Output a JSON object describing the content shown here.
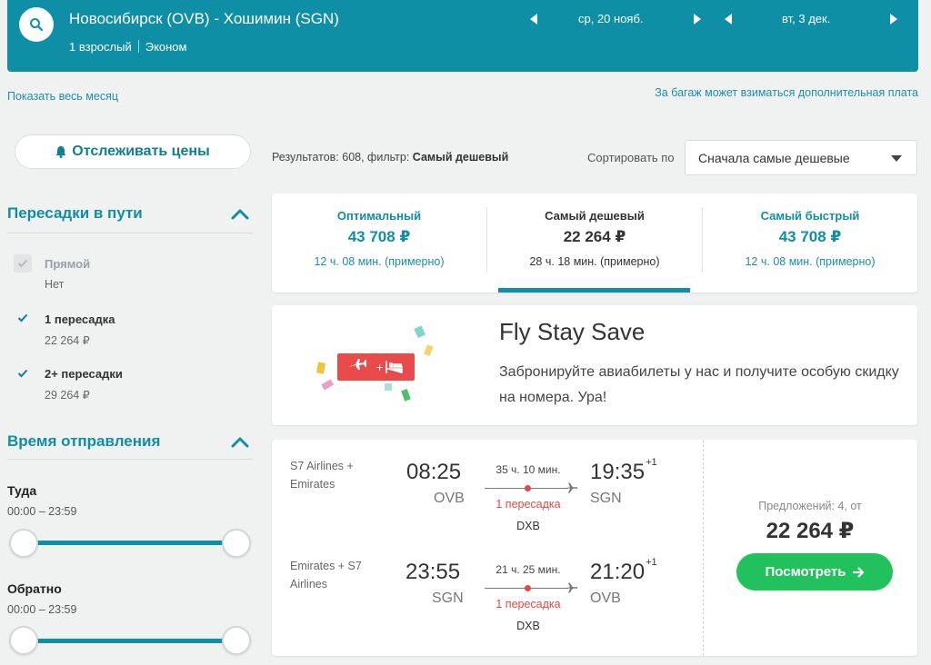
{
  "header": {
    "route": "Новосибирск (OVB) - Хошимин (SGN)",
    "passengers": "1 взрослый",
    "cabin": "Эконом",
    "depart_date": "ср, 20 нояб.",
    "return_date": "вт, 3 дек."
  },
  "links": {
    "show_month": "Показать весь месяц",
    "baggage_note": "За багаж может взиматься дополнительная плата"
  },
  "track_prices": {
    "label": "Отслеживать цены"
  },
  "filters": {
    "stops": {
      "title": "Пересадки в пути",
      "options": [
        {
          "label": "Прямой",
          "price": "Нет",
          "checked": true,
          "disabled": true
        },
        {
          "label": "1 пересадка",
          "price": "22 264 ₽",
          "checked": true,
          "disabled": false
        },
        {
          "label": "2+ пересадки",
          "price": "29 264 ₽",
          "checked": true,
          "disabled": false
        }
      ]
    },
    "departure_time": {
      "title": "Время отправления",
      "outbound_label": "Туда",
      "outbound_range": "00:00 – 23:59",
      "return_label": "Обратно",
      "return_range": "00:00 – 23:59"
    }
  },
  "results": {
    "count_prefix": "Результатов: 608, фильтр:",
    "filter_name": "Самый дешевый",
    "sort_label": "Сортировать по",
    "sort_value": "Сначала самые дешевые"
  },
  "tabs": [
    {
      "title": "Оптимальный",
      "price": "43 708 ₽",
      "duration": "12 ч. 08 мин. (примерно)"
    },
    {
      "title": "Самый дешевый",
      "price": "22 264 ₽",
      "duration": "28 ч. 18 мин. (примерно)"
    },
    {
      "title": "Самый быстрый",
      "price": "43 708 ₽",
      "duration": "12 ч. 08 мин. (примерно)"
    }
  ],
  "promo": {
    "title": "Fly Stay Save",
    "text": "Забронируйте авиабилеты у нас и получите особую скидку на номера. Ура!"
  },
  "ticket": {
    "legs": [
      {
        "airline": "S7 Airlines + Emirates",
        "dep_time": "08:25",
        "dep_code": "OVB",
        "arr_time": "19:35",
        "arr_sup": "+1",
        "arr_code": "SGN",
        "duration": "35 ч. 10 мин.",
        "stops": "1 пересадка",
        "via": "DXB"
      },
      {
        "airline": "Emirates + S7 Airlines",
        "dep_time": "23:55",
        "dep_code": "SGN",
        "arr_time": "21:20",
        "arr_sup": "+1",
        "arr_code": "OVB",
        "duration": "21 ч. 25 мин.",
        "stops": "1 пересадка",
        "via": "DXB"
      }
    ],
    "offers": "Предложений: 4, от",
    "price": "22 264 ₽",
    "view_button": "Посмотреть"
  },
  "colors": {
    "brand": "#0f8fa5",
    "cta": "#21c25e",
    "stops": "#e14a4a"
  }
}
